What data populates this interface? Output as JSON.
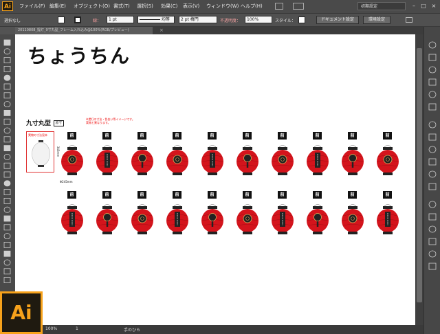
{
  "app": {
    "logo": "Ai",
    "big_logo": "Ai"
  },
  "menu": [
    "ファイル(F)",
    "編集(E)",
    "オブジェクト(O)",
    "書式(T)",
    "選択(S)",
    "効果(C)",
    "表示(V)",
    "ウィンドウ(W)",
    "ヘルプ(H)"
  ],
  "workspace": "初期設定",
  "window_buttons": [
    "–",
    "□",
    "×"
  ],
  "control": {
    "selection": "選択なし",
    "stroke_label": "線：",
    "stroke_width": "1 pt",
    "stroke_profile": "均等",
    "brush": "2 pt 楕円",
    "opacity_label": "不透明度：",
    "opacity": "100%",
    "style_label": "スタイル：",
    "doc_setup": "ドキュメント設定",
    "prefs": "環境設定"
  },
  "tab": {
    "title": "20110808_提灯_9寸丸型_フレーム入れ込み@100%(RGB/プレビュー)",
    "close": "×"
  },
  "status": {
    "zoom": "100%",
    "page": "1",
    "tool": "手のひら"
  },
  "artboard": {
    "title": "ちょうちん",
    "section_title": "九寸丸型",
    "section_badge": "原寸",
    "note_line1": "※提灯の寸法・色合い等イメージです。",
    "note_line2": "実物と異なります。",
    "ref_label": "実物の寸法見本",
    "dim_width": "Φ245mm",
    "dim_height": "345mm",
    "front_label": "前"
  },
  "colors": {
    "lantern_red": "#d4141c",
    "lantern_dark": "#a00d13",
    "accent": "#f7a21b"
  },
  "toolbar_icons": [
    "selection-tool-icon",
    "direct-selection-tool-icon",
    "magic-wand-icon",
    "lasso-icon",
    "pen-icon",
    "type-icon",
    "line-icon",
    "rectangle-icon",
    "paintbrush-icon",
    "pencil-icon",
    "blob-brush-icon",
    "eraser-icon",
    "rotate-icon",
    "scale-icon",
    "width-icon",
    "free-transform-icon",
    "shape-builder-icon",
    "perspective-icon",
    "mesh-icon",
    "gradient-icon",
    "eyedropper-icon",
    "blend-icon",
    "symbol-sprayer-icon",
    "column-graph-icon",
    "artboard-icon",
    "slice-icon",
    "hand-icon",
    "zoom-icon"
  ],
  "panel_icons": [
    "color-panel-icon",
    "color-guide-icon",
    "swatches-icon",
    "brushes-icon",
    "symbols-icon",
    "stroke-panel-icon",
    "gradient-panel-icon",
    "transparency-icon",
    "appearance-icon",
    "graphic-styles-icon",
    "layers-icon",
    "artboards-panel-icon",
    "character-icon",
    "paragraph-icon",
    "opentype-icon",
    "align-icon",
    "pathfinder-icon",
    "transform-icon"
  ]
}
